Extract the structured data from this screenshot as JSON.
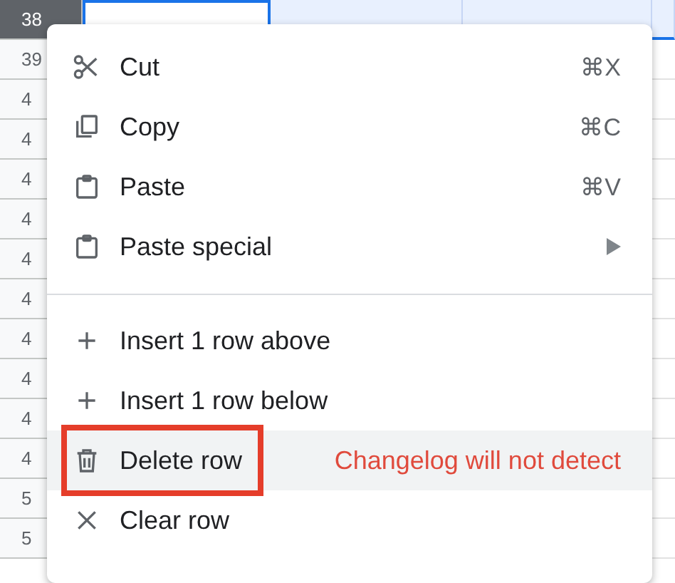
{
  "sheet": {
    "rows": [
      {
        "number": "38",
        "selected": true
      },
      {
        "number": "39",
        "selected": false
      },
      {
        "number": "4",
        "selected": false
      },
      {
        "number": "4",
        "selected": false
      },
      {
        "number": "4",
        "selected": false
      },
      {
        "number": "4",
        "selected": false
      },
      {
        "number": "4",
        "selected": false
      },
      {
        "number": "4",
        "selected": false
      },
      {
        "number": "4",
        "selected": false
      },
      {
        "number": "4",
        "selected": false
      },
      {
        "number": "4",
        "selected": false
      },
      {
        "number": "4",
        "selected": false
      },
      {
        "number": "5",
        "selected": false
      },
      {
        "number": "5",
        "selected": false
      }
    ]
  },
  "context_menu": {
    "sections": [
      {
        "items": [
          {
            "label": "Cut",
            "shortcut": "⌘X",
            "highlighted": false,
            "submenu": false
          },
          {
            "label": "Copy",
            "shortcut": "⌘C",
            "highlighted": false,
            "submenu": false
          },
          {
            "label": "Paste",
            "shortcut": "⌘V",
            "highlighted": false,
            "submenu": false
          },
          {
            "label": "Paste special",
            "highlighted": false,
            "submenu": true
          }
        ]
      },
      {
        "items": [
          {
            "label": "Insert 1 row above",
            "highlighted": false,
            "submenu": false
          },
          {
            "label": "Insert 1 row below",
            "highlighted": false,
            "submenu": false
          },
          {
            "label": "Delete row",
            "highlighted": true,
            "submenu": false,
            "annotation": "Changelog will not detect"
          },
          {
            "label": "Clear row",
            "highlighted": false,
            "submenu": false
          }
        ]
      }
    ]
  }
}
